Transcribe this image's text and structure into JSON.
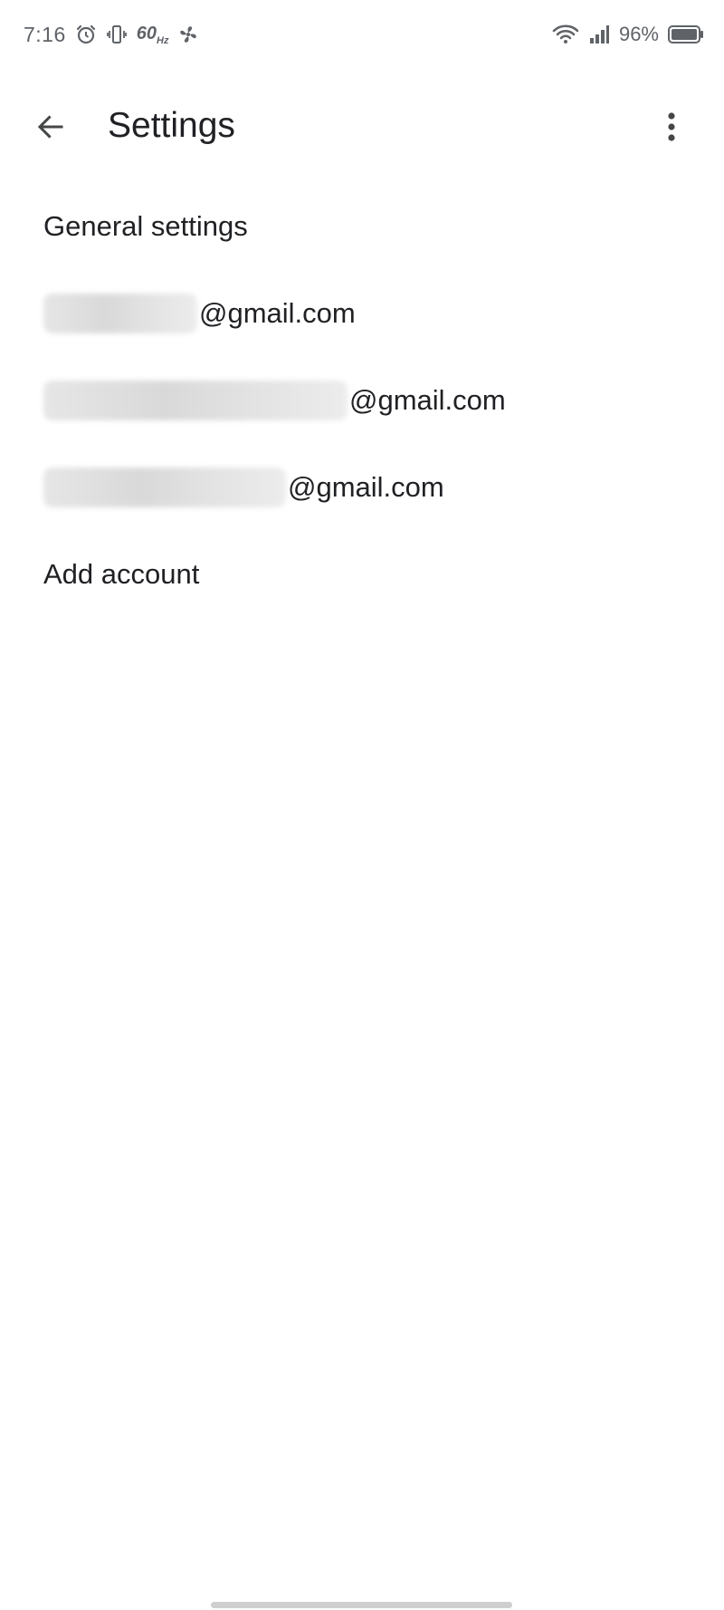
{
  "status_bar": {
    "time": "7:16",
    "refresh_rate": "60",
    "refresh_rate_unit": "Hz",
    "battery_percent": "96%",
    "icons": [
      "alarm-icon",
      "vibrate-icon",
      "fan-icon",
      "wifi-icon",
      "signal-icon",
      "battery-icon"
    ]
  },
  "app_bar": {
    "title": "Settings",
    "back_icon": "arrow-back-icon",
    "overflow_icon": "more-vert-icon"
  },
  "settings": {
    "general_label": "General settings",
    "accounts": [
      {
        "domain": "@gmail.com",
        "local_redacted": true
      },
      {
        "domain": "@gmail.com",
        "local_redacted": true
      },
      {
        "domain": "@gmail.com",
        "local_redacted": true
      }
    ],
    "add_account_label": "Add account"
  },
  "colors": {
    "background": "#ffffff",
    "text_primary": "#202124",
    "icon_gray": "#5f6368"
  }
}
